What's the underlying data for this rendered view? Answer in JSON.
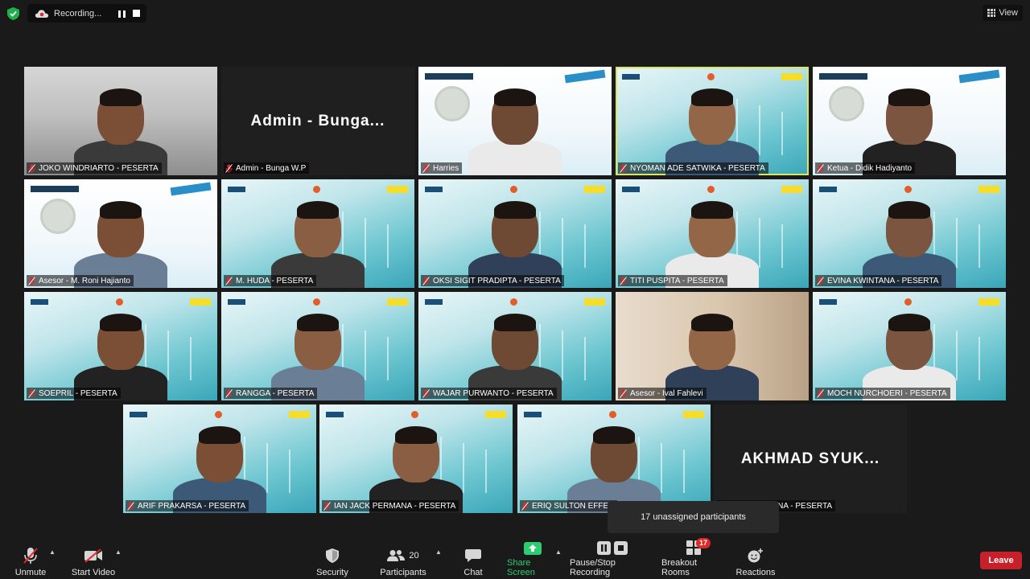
{
  "recording": {
    "label": "Recording..."
  },
  "view": {
    "label": "View"
  },
  "tiles": [
    {
      "name": "JOKO WINDRIARTO - PESERTA",
      "type": "video",
      "bg": "outdoor"
    },
    {
      "name": "Admin - Bunga W.P",
      "type": "name",
      "big": "Admin  -  Bunga..."
    },
    {
      "name": "Harries",
      "type": "video",
      "bg": "kebtke"
    },
    {
      "name": "NYOMAN ADE SATWIKA - PESERTA",
      "type": "video",
      "bg": "pln",
      "active": true
    },
    {
      "name": "Ketua - Didik Hadiyanto",
      "type": "video",
      "bg": "kebtke"
    },
    {
      "name": "Asesor - M. Roni Hajianto",
      "type": "video",
      "bg": "kebtke"
    },
    {
      "name": "M. HUDA - PESERTA",
      "type": "video",
      "bg": "pln"
    },
    {
      "name": "OKSI SIGIT PRADIPTA - PESERTA",
      "type": "video",
      "bg": "pln"
    },
    {
      "name": "TITI PUSPITA - PESERTA",
      "type": "video",
      "bg": "pln"
    },
    {
      "name": "EVINA KWINTANA - PESERTA",
      "type": "video",
      "bg": "pln"
    },
    {
      "name": "SOEPRIL - PESERTA",
      "type": "video",
      "bg": "pln"
    },
    {
      "name": "RANGGA - PESERTA",
      "type": "video",
      "bg": "pln"
    },
    {
      "name": "WAJAR PURWANTO - PESERTA",
      "type": "video",
      "bg": "pln"
    },
    {
      "name": "Asesor - Ival Fahlevi",
      "type": "video",
      "bg": "room"
    },
    {
      "name": "MOCH NURCHOERI - PESERTA",
      "type": "video",
      "bg": "pln"
    },
    {
      "name": "ARIF PRAKARSA - PESERTA",
      "type": "video",
      "bg": "pln"
    },
    {
      "name": "IAN JACK PERMANA - PESERTA",
      "type": "video",
      "bg": "pln"
    },
    {
      "name": "ERIQ SULTON EFFEN",
      "type": "video",
      "bg": "pln"
    },
    {
      "name": "UKRI MAULANA - PESERTA",
      "type": "name",
      "big": "AKHMAD  SYUK..."
    }
  ],
  "tooltip": {
    "text": "17 unassigned participants"
  },
  "toolbar": {
    "unmute": "Unmute",
    "start_video": "Start Video",
    "security": "Security",
    "participants": "Participants",
    "participants_count": "20",
    "chat": "Chat",
    "share_screen": "Share Screen",
    "pause_stop": "Pause/Stop Recording",
    "breakout": "Breakout Rooms",
    "breakout_badge": "17",
    "reactions": "Reactions",
    "leave": "Leave"
  },
  "colors": {
    "active_border": "#d8e664",
    "leave": "#c8202b",
    "share": "#2ecc71",
    "badge": "#e02828"
  }
}
